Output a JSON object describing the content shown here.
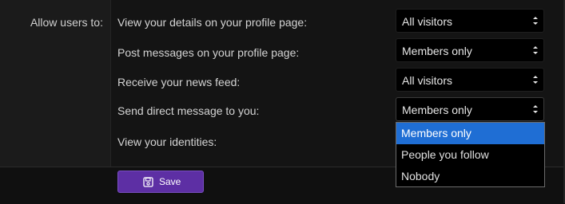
{
  "section_label": "Allow users to:",
  "rows": [
    {
      "label": "View your details on your profile page:",
      "value": "All visitors"
    },
    {
      "label": "Post messages on your profile page:",
      "value": "Members only"
    },
    {
      "label": "Receive your news feed:",
      "value": "All visitors"
    },
    {
      "label": "Send direct message to you:",
      "value": "Members only"
    },
    {
      "label": "View your identities:",
      "value": ""
    }
  ],
  "dropdown": {
    "options": [
      "Members only",
      "People you follow",
      "Nobody"
    ],
    "selected": "Members only"
  },
  "save_button": {
    "label": "Save",
    "icon": "floppy-disk-icon"
  },
  "colors": {
    "accent": "#5d2fa4",
    "highlight": "#1f6ed4"
  }
}
